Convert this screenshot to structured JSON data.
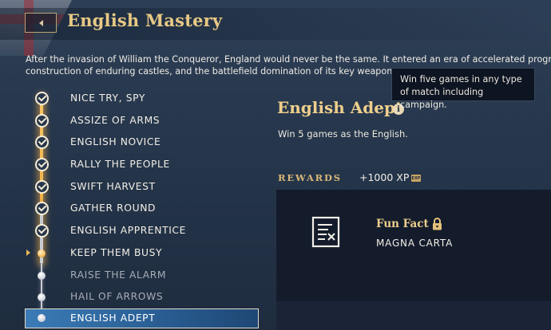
{
  "header": {
    "title": "English Mastery",
    "back_label": "back"
  },
  "intro": {
    "line1": "After the invasion of William the Conqueror, England would never be the same. It entered an era of accelerated progr",
    "line2": "construction of enduring castles, and the battlefield domination of its key weapon"
  },
  "tooltip": {
    "text": "Win five games in any type of match including campaign."
  },
  "achievements": [
    {
      "label": "NICE TRY, SPY",
      "state": "completed"
    },
    {
      "label": "ASSIZE OF ARMS",
      "state": "completed"
    },
    {
      "label": "ENGLISH NOVICE",
      "state": "completed"
    },
    {
      "label": "RALLY THE PEOPLE",
      "state": "completed"
    },
    {
      "label": "SWIFT HARVEST",
      "state": "completed"
    },
    {
      "label": "GATHER ROUND",
      "state": "completed"
    },
    {
      "label": "ENGLISH APPRENTICE",
      "state": "completed"
    },
    {
      "label": "KEEP THEM BUSY",
      "state": "current"
    },
    {
      "label": "RAISE THE ALARM",
      "state": "locked"
    },
    {
      "label": "HAIL OF ARROWS",
      "state": "locked"
    },
    {
      "label": "ENGLISH ADEPT",
      "state": "selected"
    }
  ],
  "detail": {
    "title": "English Adept",
    "description": "Win 5 games as the English.",
    "rewards_label": "REWARDS",
    "xp": "+1000 XP",
    "xp_badge": "EXP",
    "reward": {
      "name": "Fun Fact",
      "subtitle": "MAGNA CARTA"
    }
  },
  "colors": {
    "gold_accent": "#efcf8c",
    "selected_bg": "#2a5f94",
    "panel_bg": "#141c2c"
  }
}
